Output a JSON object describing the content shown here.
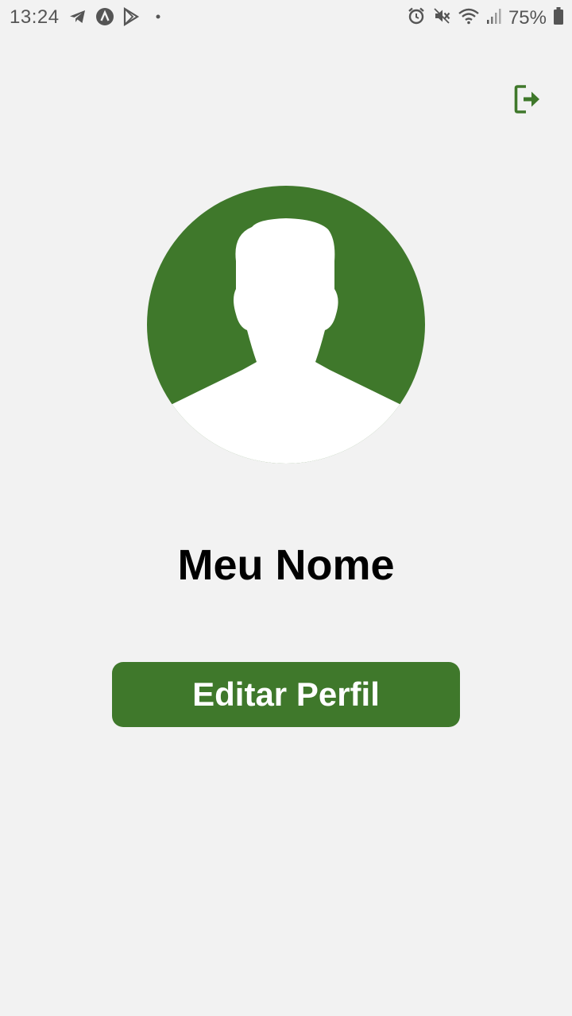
{
  "status_bar": {
    "time": "13:24",
    "battery": "75%",
    "left_icons": [
      "telegram-icon",
      "app-a-icon",
      "play-store-icon",
      "notification-dot-icon"
    ],
    "right_icons": [
      "alarm-icon",
      "mute-icon",
      "wifi-icon",
      "signal-icon",
      "battery-icon"
    ]
  },
  "header": {
    "logout_icon": "logout-icon"
  },
  "profile": {
    "avatar_icon": "default-user-avatar",
    "name": "Meu Nome",
    "edit_button_label": "Editar Perfil"
  },
  "colors": {
    "primary": "#3f782b",
    "background": "#f2f2f2",
    "text": "#000000",
    "button_text": "#ffffff",
    "status_text": "#555555"
  }
}
